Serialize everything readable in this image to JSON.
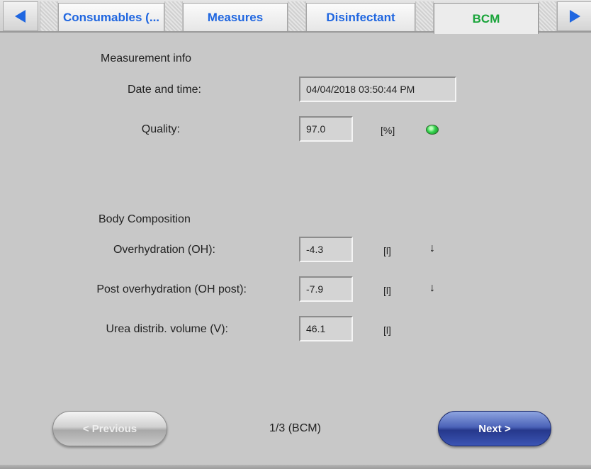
{
  "tabs": [
    {
      "label": "Consumables (...",
      "active": false
    },
    {
      "label": "Measures",
      "active": false
    },
    {
      "label": "Disinfectant",
      "active": false
    },
    {
      "label": "BCM",
      "active": true
    }
  ],
  "icons": {
    "prev_tab": "arrow-left-icon",
    "next_tab": "arrow-right-icon",
    "quality_led": "status-led-icon",
    "trend_down": "arrow-down-icon"
  },
  "colors": {
    "tab_text": "#1f66e0",
    "tab_active_text": "#19a43a",
    "led": "#33d14d",
    "next_button": "#3b55b4"
  },
  "measurement_info": {
    "title": "Measurement info",
    "date_label": "Date and time:",
    "date_value": "04/04/2018 03:50:44 PM",
    "quality_label": "Quality:",
    "quality_value": "97.0",
    "quality_unit": "[%]"
  },
  "body_composition": {
    "title": "Body Composition",
    "rows": [
      {
        "label": "Overhydration (OH):",
        "value": "-4.3",
        "unit": "[l]",
        "trend": "↓"
      },
      {
        "label": "Post overhydration (OH post):",
        "value": "-7.9",
        "unit": "[l]",
        "trend": "↓"
      },
      {
        "label": "Urea distrib. volume (V):",
        "value": "46.1",
        "unit": "[l]"
      }
    ]
  },
  "footer": {
    "previous_label": "< Previous",
    "next_label": "Next >",
    "page_indicator": "1/3 (BCM)"
  }
}
